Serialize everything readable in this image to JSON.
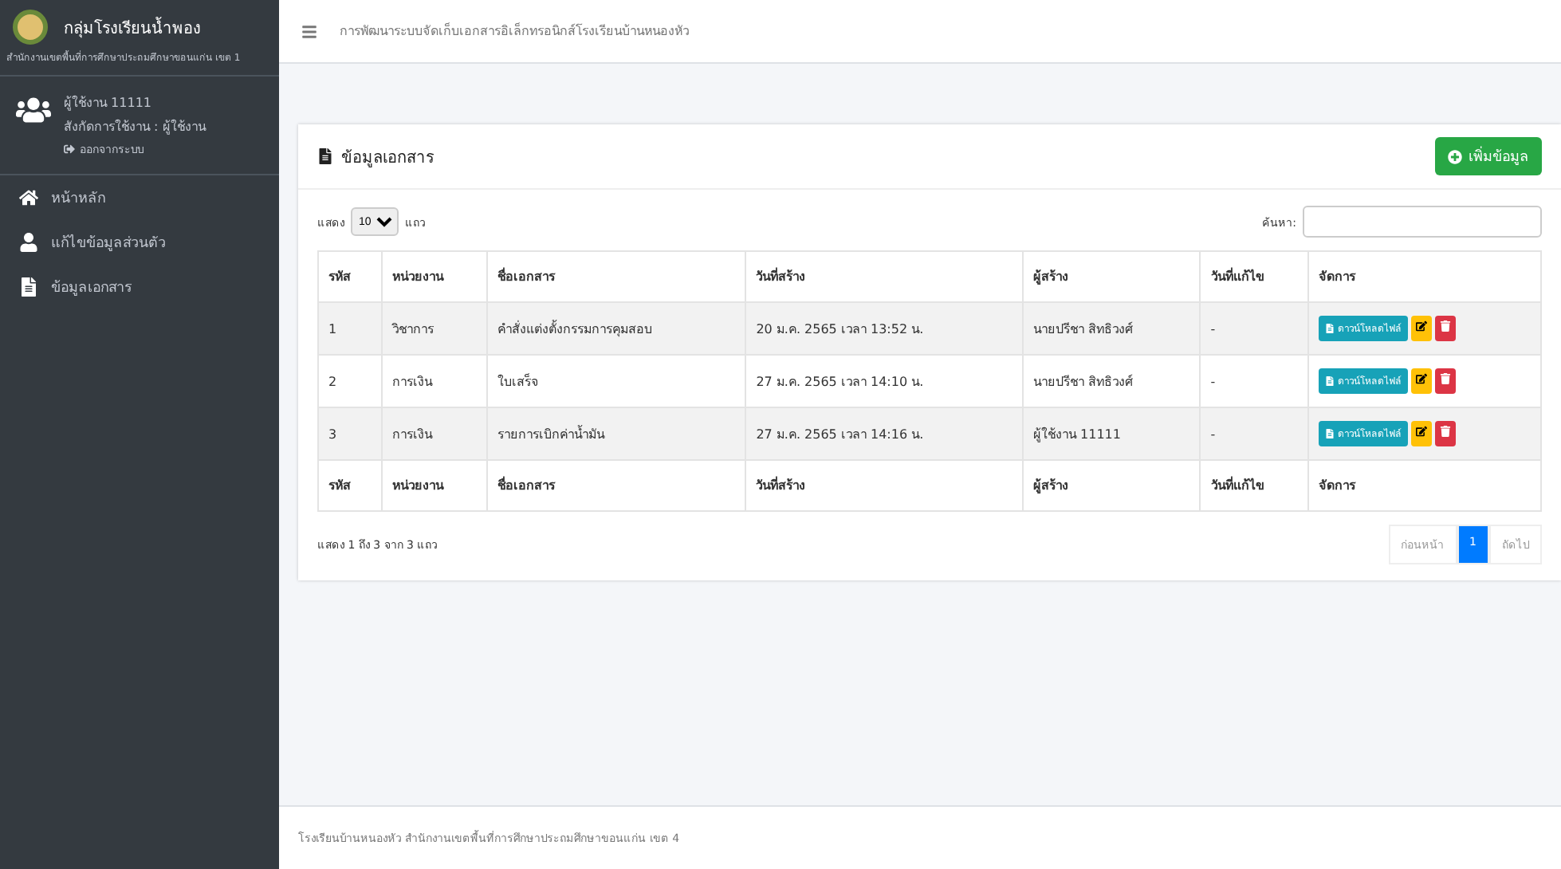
{
  "sidebar": {
    "brand": "กลุ่มโรงเรียนน้ำพอง",
    "subtitle": "สำนักงานเขตพื้นที่การศึกษาประถมศึกษาขอนแก่น เขต 1",
    "user": {
      "name": "ผู้ใช้งาน 11111",
      "role": "สังกัดการใช้งาน : ผู้ใช้งาน",
      "logout": "ออกจากระบบ"
    },
    "items": [
      {
        "label": "หน้าหลัก",
        "selected": false
      },
      {
        "label": "แก้ไขข้อมูลส่วนตัว",
        "selected": false
      },
      {
        "label": "ข้อมูลเอกสาร",
        "selected": false
      }
    ]
  },
  "topbar": {
    "title": "การพัฒนาระบบจัดเก็บเอกสารอิเล็กทรอนิกส์โรงเรียนบ้านหนองหัว"
  },
  "card": {
    "title": "ข้อมูลเอกสาร",
    "add_button": "เพิ่มข้อมูล",
    "length": {
      "prefix": "แสดง",
      "value": "10",
      "suffix": "แถว"
    },
    "search_label": "ค้นหา:",
    "columns": [
      "รหัส",
      "หน่วยงาน",
      "ชื่อเอกสาร",
      "วันที่สร้าง",
      "ผู้สร้าง",
      "วันที่แก้ไข",
      "จัดการ"
    ],
    "rows": [
      {
        "id": "1",
        "unit": "วิชาการ",
        "name": "คำสั่งแต่งตั้งกรรมการคุมสอบ",
        "created": "20 ม.ค. 2565 เวลา 13:52 น.",
        "creator": "นายปรีชา สิทธิวงศ์",
        "modified": "-",
        "download": "ดาวน์โหลดไฟล์"
      },
      {
        "id": "2",
        "unit": "การเงิน",
        "name": "ใบเสร็จ",
        "created": "27 ม.ค. 2565 เวลา 14:10 น.",
        "creator": "นายปรีชา สิทธิวงศ์",
        "modified": "-",
        "download": "ดาวน์โหลดไฟล์"
      },
      {
        "id": "3",
        "unit": "การเงิน",
        "name": "รายการเบิกค่าน้ำมัน",
        "created": "27 ม.ค. 2565 เวลา 14:16 น.",
        "creator": "ผู้ใช้งาน 11111",
        "modified": "-",
        "download": "ดาวน์โหลดไฟล์"
      }
    ],
    "footer_columns": [
      "รหัส",
      "หน่วยงาน",
      "ชื่อเอกสาร",
      "วันที่สร้าง",
      "ผู้สร้าง",
      "วันที่แก้ไข",
      "จัดการ"
    ],
    "info": "แสดง 1 ถึง 3 จาก 3 แถว",
    "pagination": [
      {
        "label": "ก่อนหน้า",
        "selected": false
      },
      {
        "label": "1",
        "selected": true
      },
      {
        "label": "ถัดไป",
        "selected": false
      }
    ]
  },
  "footer": "โรงเรียนบ้านหนองหัว สำนักงานเขตพื้นที่การศึกษาประถมศึกษาขอนแก่น เขต 4"
}
